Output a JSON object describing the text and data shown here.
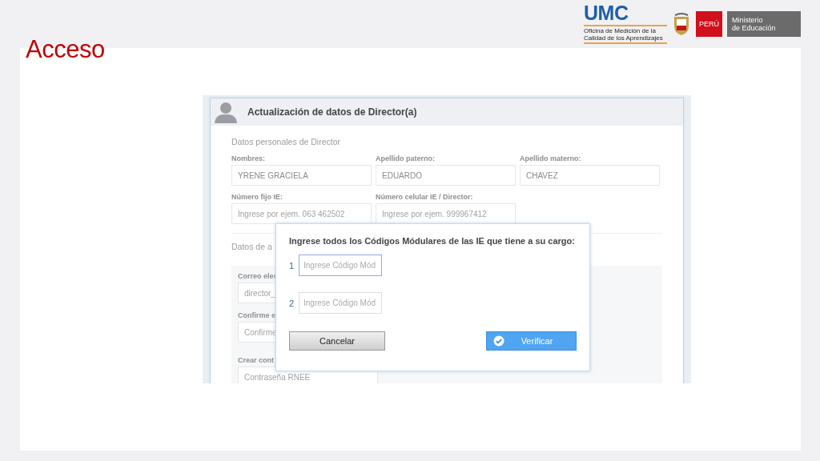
{
  "slide": {
    "title": "Acceso",
    "logos": {
      "umc": "UMC",
      "umc_subtitle": "Oficina de Medición de la Calidad de los Aprendizajes",
      "peru": "PERÚ",
      "ministry_line_1": "Ministerio",
      "ministry_line_2": "de Educación"
    }
  },
  "form": {
    "header": "Actualización de datos de Director(a)",
    "section_1": "Datos personales de Director",
    "rows": [
      [
        {
          "label": "Nombres:",
          "value": "YRENE GRACIELA"
        },
        {
          "label": "Apellido paterno:",
          "value": "EDUARDO"
        },
        {
          "label": "Apellido materno:",
          "value": "CHAVEZ"
        }
      ],
      [
        {
          "label": "Número fijo IE:",
          "placeholder": "Ingrese por ejem. 063 462502"
        },
        {
          "label": "Número celular IE / Director:",
          "placeholder": "Ingrese por ejem. 999967412"
        }
      ]
    ],
    "section_2": "Datos de a",
    "panel_fields": [
      {
        "label": "Correo elec",
        "placeholder": "director_"
      },
      {
        "label": "Confirme e",
        "placeholder": "Confirme"
      },
      {
        "label": "Crear cont",
        "placeholder": "Contraseña RNEE"
      }
    ]
  },
  "dialog": {
    "prompt": "Ingrese todos los Códigos Módulares de las IE que tiene a su cargo:",
    "code_fields": [
      {
        "number": "1",
        "placeholder": "Ingrese Código Mód",
        "focused": true
      },
      {
        "number": "2",
        "placeholder": "Ingrese Código Mód",
        "focused": false
      }
    ],
    "buttons": [
      {
        "label": "Cancelar",
        "kind": "secondary"
      },
      {
        "label": "Verificar",
        "kind": "primary"
      }
    ]
  }
}
